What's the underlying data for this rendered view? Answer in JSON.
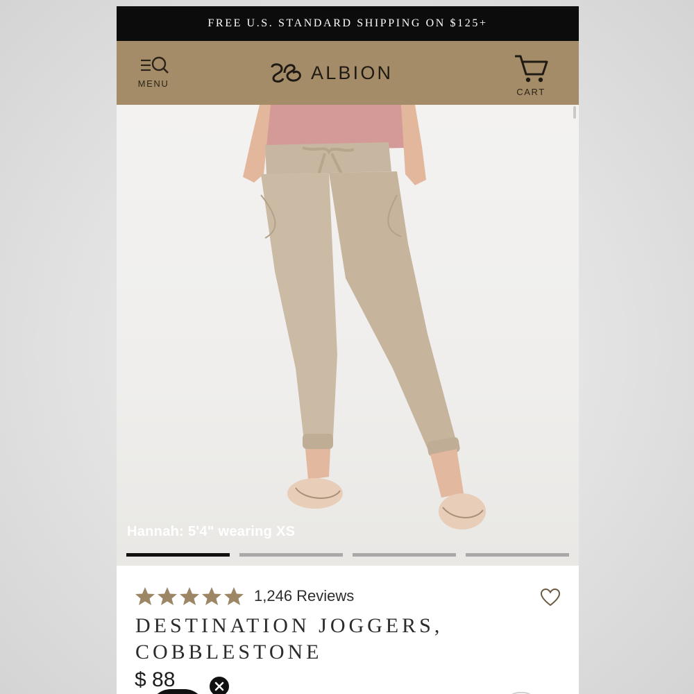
{
  "promo": {
    "text": "FREE U.S. STANDARD SHIPPING ON $125+"
  },
  "header": {
    "menu_label": "MENU",
    "brand_name": "ALBION",
    "cart_label": "CART",
    "background_color": "#a58c68"
  },
  "gallery": {
    "caption": "Hannah: 5'4\" wearing XS",
    "slide_count": 4,
    "active_slide": 1
  },
  "product": {
    "rating_stars": 5,
    "reviews_text": "1,246 Reviews",
    "title_line1": "DESTINATION JOGGERS,",
    "title_line2": "COBBLESTONE",
    "price": "$ 88",
    "star_color": "#9c8665"
  },
  "icons": {
    "menu": "menu-search-icon",
    "cart": "cart-icon",
    "wishlist": "heart-icon",
    "close": "close-icon",
    "star": "star-icon"
  }
}
